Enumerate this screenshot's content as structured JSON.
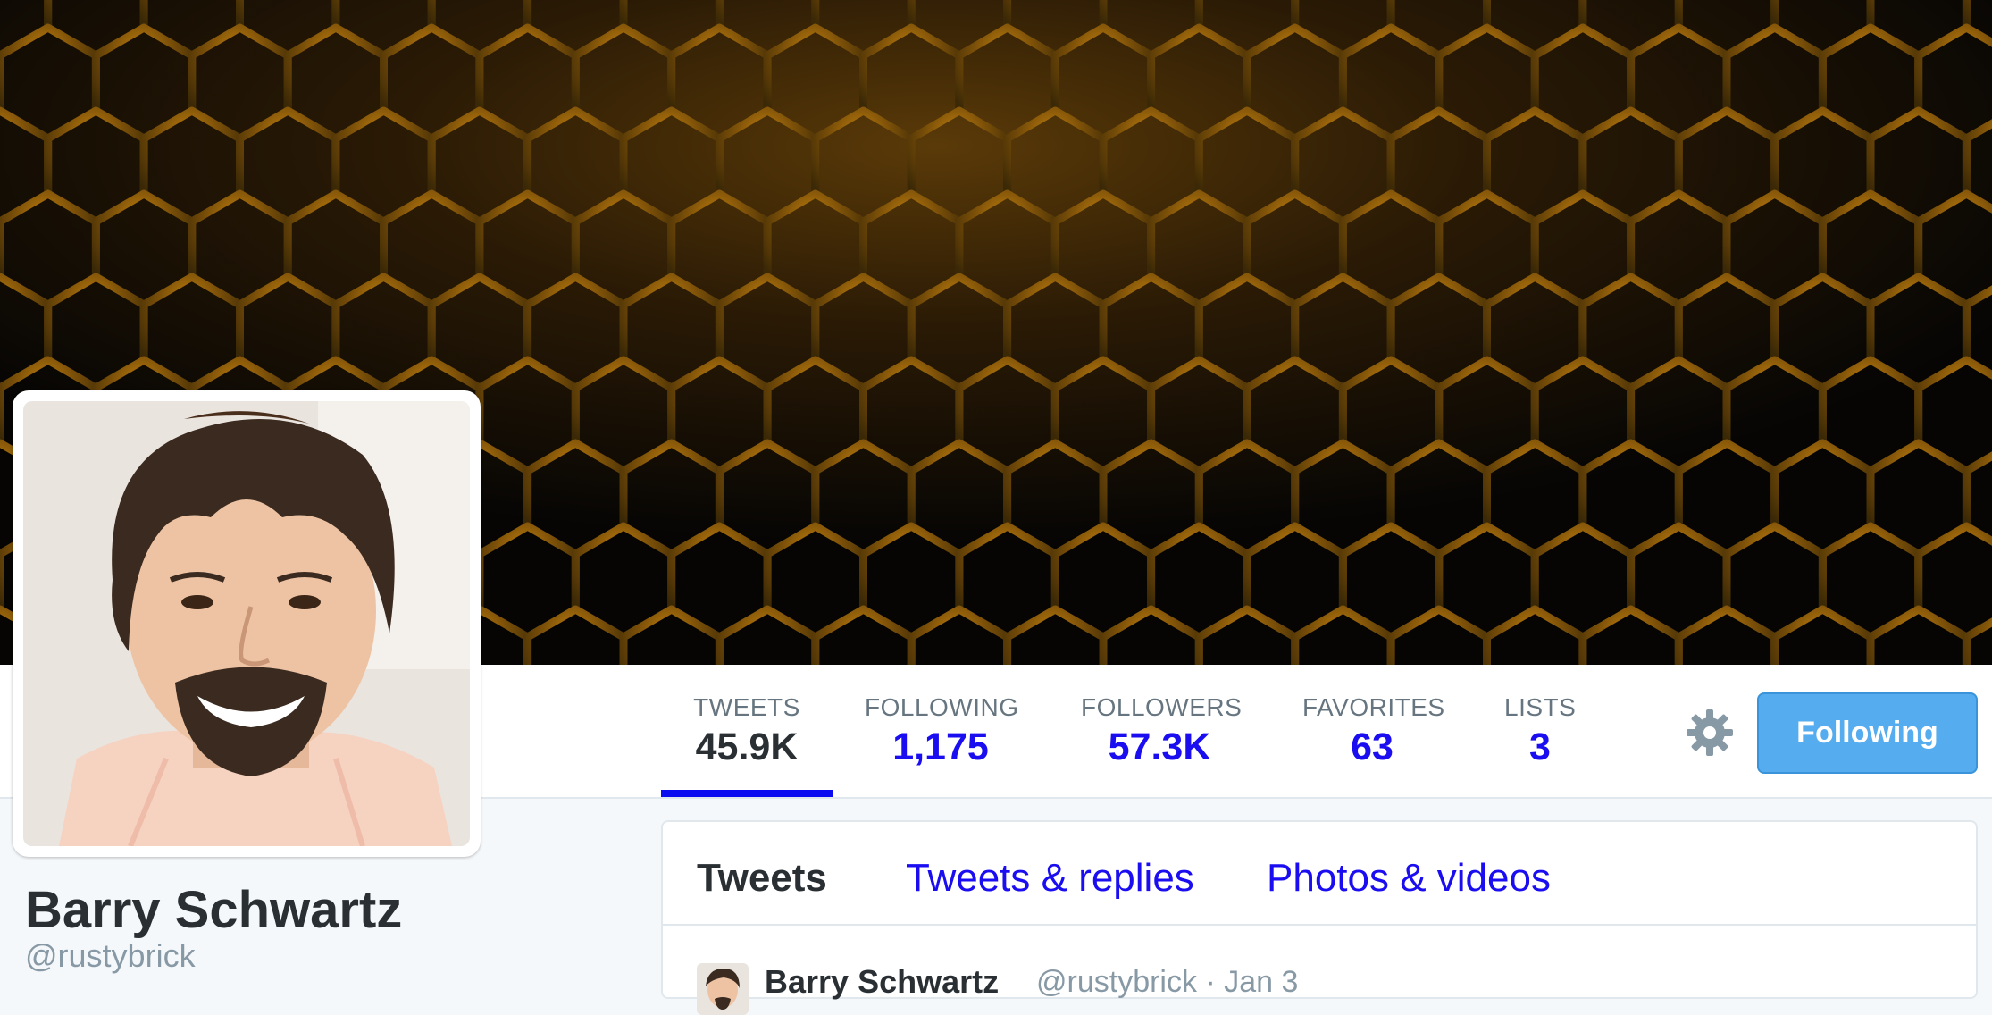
{
  "profile": {
    "name": "Barry Schwartz",
    "handle": "@rustybrick"
  },
  "stats": [
    {
      "label": "TWEETS",
      "value": "45.9K",
      "active": true
    },
    {
      "label": "FOLLOWING",
      "value": "1,175"
    },
    {
      "label": "FOLLOWERS",
      "value": "57.3K"
    },
    {
      "label": "FAVORITES",
      "value": "63"
    },
    {
      "label": "LISTS",
      "value": "3"
    }
  ],
  "actions": {
    "follow_label": "Following",
    "settings_icon": "gear-icon"
  },
  "timeline": {
    "tabs": [
      {
        "label": "Tweets",
        "active": true
      },
      {
        "label": "Tweets & replies"
      },
      {
        "label": "Photos & videos"
      }
    ],
    "tweet": {
      "author": "Barry Schwartz",
      "handle": "@rustybrick",
      "date": "Jan 3",
      "separator": "·"
    }
  },
  "colors": {
    "accent_link": "#1a0df0",
    "follow_button": "#55acee",
    "banner_hex_stroke": "#8a5a08",
    "page_background": "#f5f8fa"
  }
}
